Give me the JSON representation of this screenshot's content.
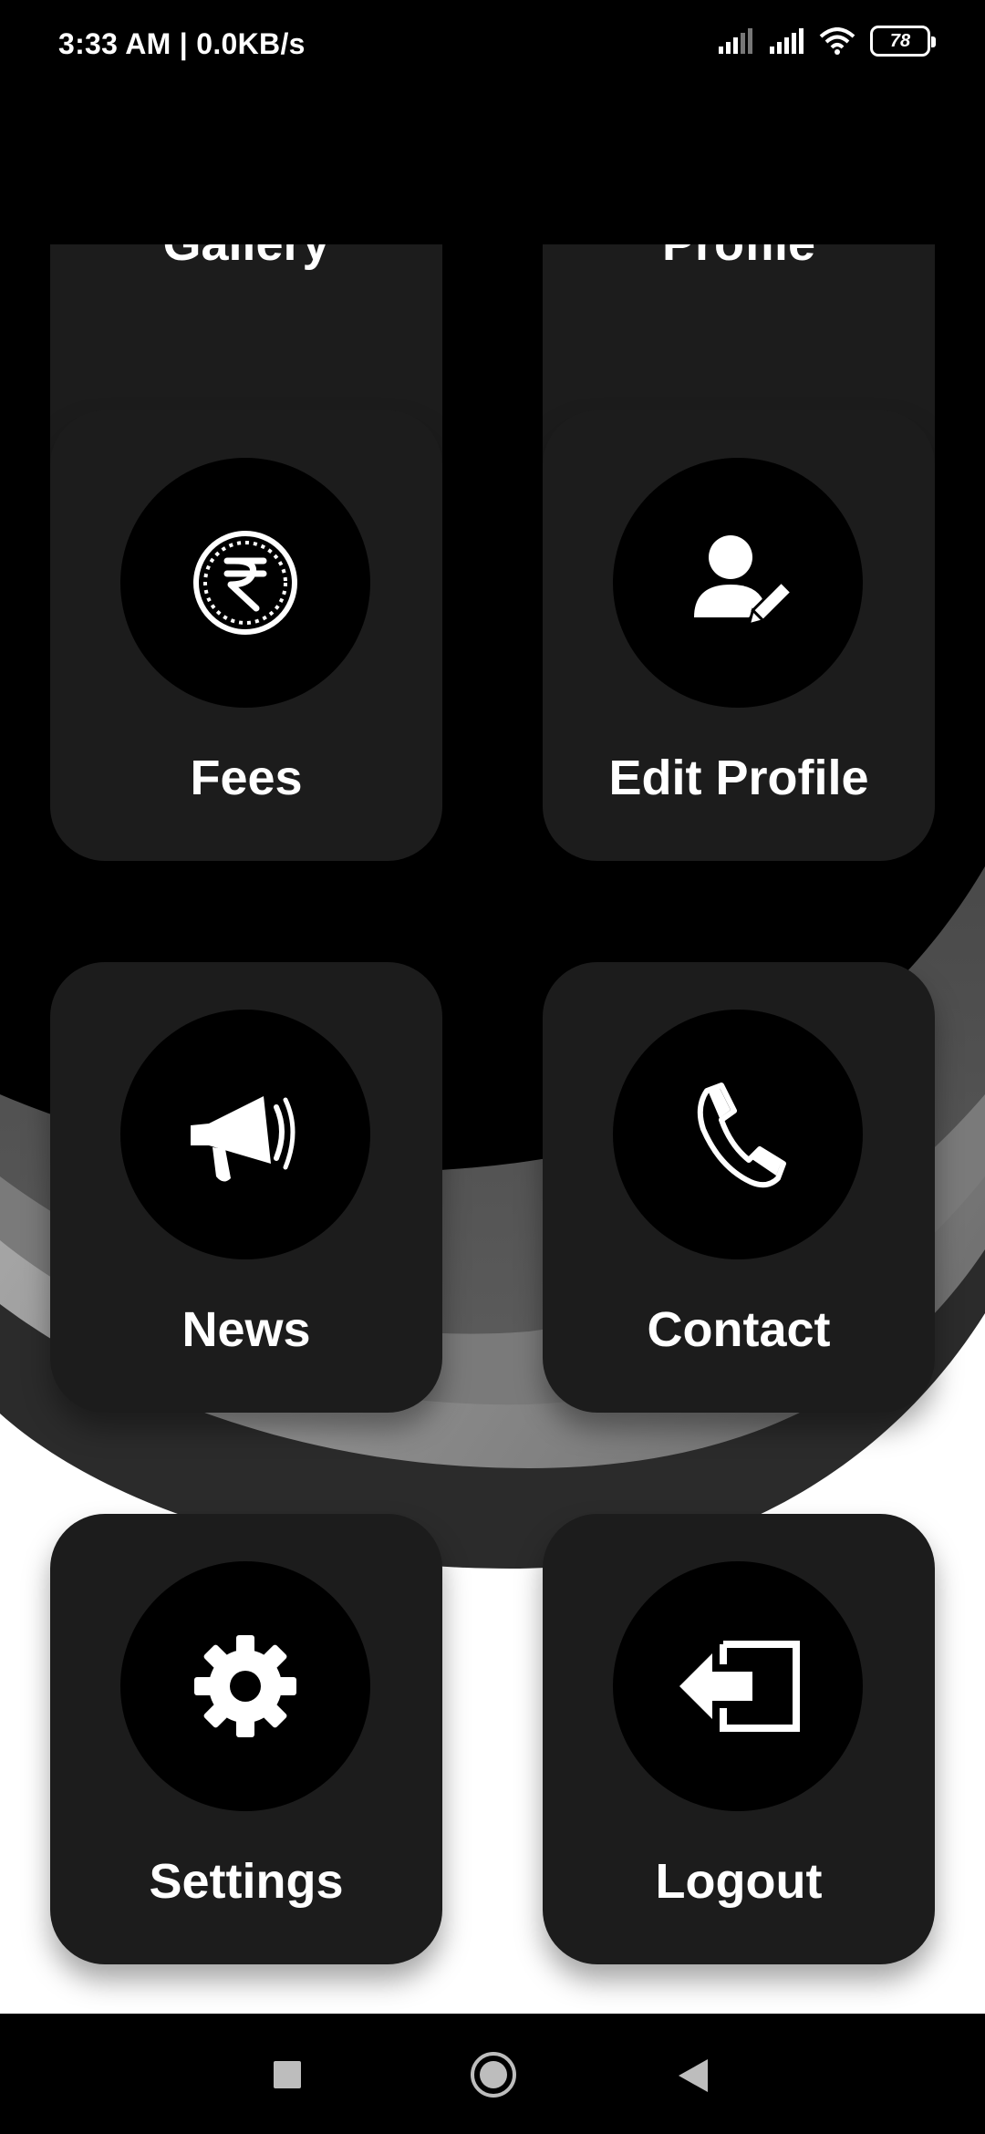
{
  "status_bar": {
    "time_speed": "3:33 AM | 0.0KB/s",
    "battery_level": "78",
    "icons": [
      "signal-icon",
      "signal-icon",
      "wifi-icon",
      "battery-icon"
    ]
  },
  "menu": {
    "items": [
      {
        "label": "Gallery",
        "icon": "gallery-icon"
      },
      {
        "label": "Profile",
        "icon": "profile-icon"
      },
      {
        "label": "Fees",
        "icon": "rupee-coin-icon"
      },
      {
        "label": "Edit Profile",
        "icon": "user-edit-icon"
      },
      {
        "label": "News",
        "icon": "megaphone-icon"
      },
      {
        "label": "Contact",
        "icon": "phone-icon"
      },
      {
        "label": "Settings",
        "icon": "gear-icon"
      },
      {
        "label": "Logout",
        "icon": "logout-icon"
      }
    ]
  },
  "nav_bar": {
    "buttons": [
      "recents-button",
      "home-button",
      "back-button"
    ]
  },
  "colors": {
    "card": "#1c1c1c",
    "icon_circle": "#000000",
    "text": "#ffffff",
    "background_top": "#000000",
    "background_bottom": "#ffffff"
  }
}
